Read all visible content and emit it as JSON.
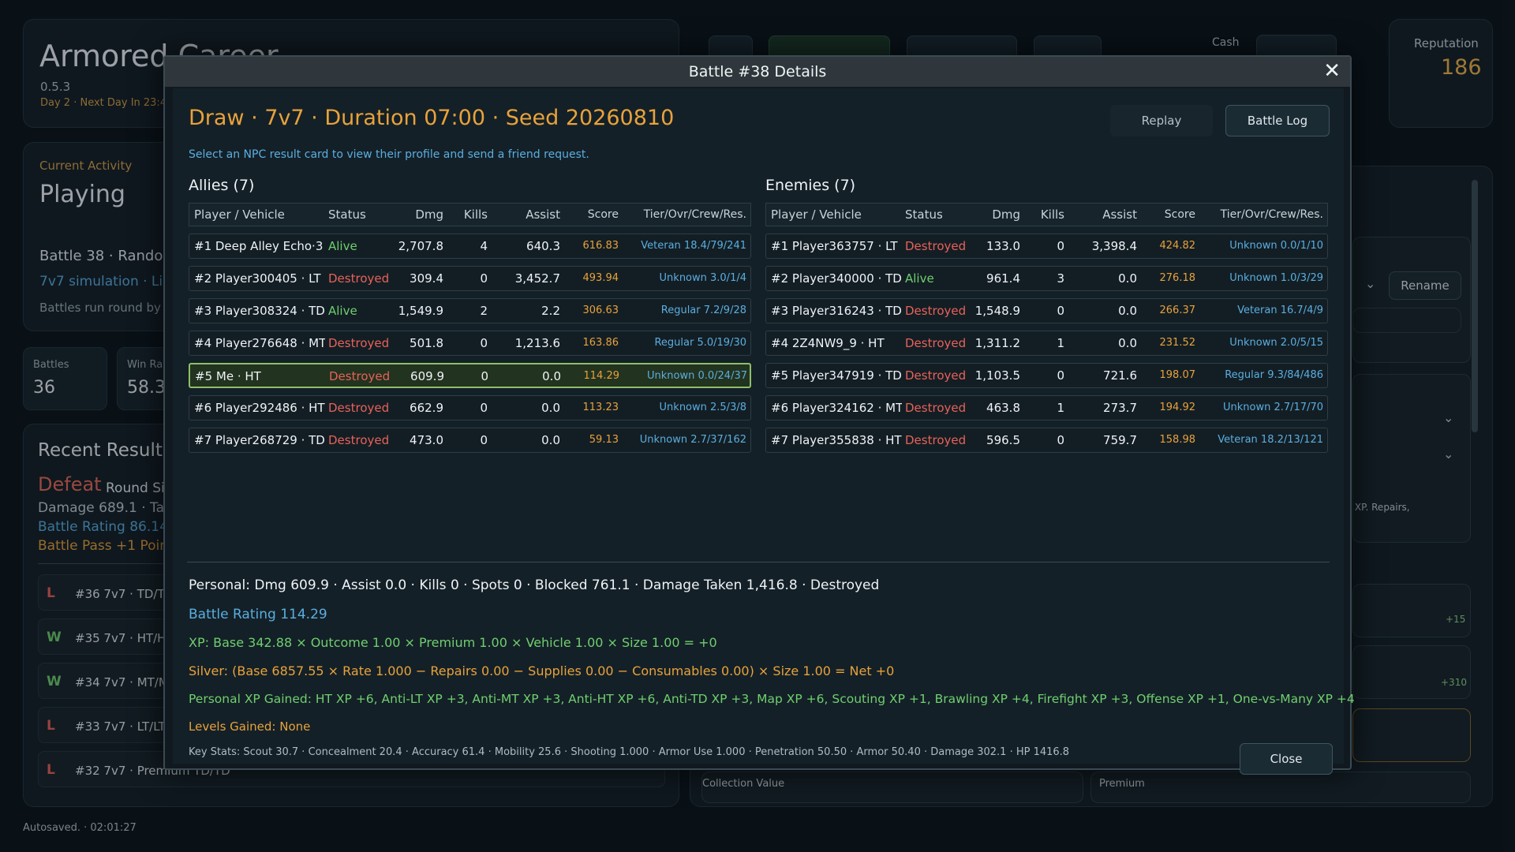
{
  "app": {
    "title": "Armored Career",
    "version": "0.5.3",
    "day": "Day 2 · Next Day In 23:45",
    "cash_label": "Cash",
    "reputation_label": "Reputation",
    "reputation_value": "186"
  },
  "activity": {
    "label": "Current Activity",
    "value": "Playing",
    "battle": "Battle 38 · Random",
    "sim": "7v7 simulation · Line",
    "note": "Battles run round by r"
  },
  "stats": {
    "battles_label": "Battles",
    "battles_value": "36",
    "winrate_label": "Win Ra",
    "winrate_value": "58.3"
  },
  "recent": {
    "title": "Recent Results",
    "outcome": "Defeat",
    "outcome_sub": "Round Si",
    "damage": "Damage 689.1 · Take",
    "rating": "Battle Rating 86.14",
    "pass": "Battle Pass +1 Point",
    "rows": [
      {
        "res": "L",
        "text": "#36  7v7 · TD/TD"
      },
      {
        "res": "W",
        "text": "#35  7v7 · HT/HT"
      },
      {
        "res": "W",
        "text": "#34  7v7 · MT/MT"
      },
      {
        "res": "L",
        "text": "#33  7v7 · LT/LT"
      },
      {
        "res": "L",
        "text": "#32  7v7 · Premium TD/TD"
      }
    ]
  },
  "right": {
    "rename": "Rename",
    "xp_repairs": "v XP. Repairs,",
    "plus_15": "+15",
    "plus_310": "+310",
    "collection": "Collection Value",
    "premium": "Premium"
  },
  "footer": {
    "status": "Autosaved.  ·  02:01:27"
  },
  "modal": {
    "title": "Battle #38 Details",
    "close_x": "✕",
    "summary": "Draw  ·  7v7  ·  Duration 07:00  ·  Seed 20260810",
    "hint": "Select an NPC result card to view their profile and send a friend request.",
    "replay": "Replay",
    "battle_log": "Battle Log",
    "close": "Close",
    "columns": {
      "name": "Player / Vehicle",
      "status": "Status",
      "dmg": "Dmg",
      "kills": "Kills",
      "assist": "Assist",
      "score": "Score",
      "tier": "Tier/Ovr/Crew/Res."
    },
    "allies_title": "Allies (7)",
    "enemies_title": "Enemies (7)",
    "allies": [
      {
        "name": "#1 Deep Alley Echo·3 ...",
        "status": "Alive",
        "dmg": "2,707.8",
        "kills": "4",
        "assist": "640.3",
        "score": "616.83",
        "tier": "Veteran 18.4/79/241"
      },
      {
        "name": "#2 Player300405 · LT",
        "status": "Destroyed",
        "dmg": "309.4",
        "kills": "0",
        "assist": "3,452.7",
        "score": "493.94",
        "tier": "Unknown 3.0/1/4"
      },
      {
        "name": "#3 Player308324 · TD",
        "status": "Alive",
        "dmg": "1,549.9",
        "kills": "2",
        "assist": "2.2",
        "score": "306.63",
        "tier": "Regular 7.2/9/28"
      },
      {
        "name": "#4 Player276648 · MT",
        "status": "Destroyed",
        "dmg": "501.8",
        "kills": "0",
        "assist": "1,213.6",
        "score": "163.86",
        "tier": "Regular 5.0/19/30"
      },
      {
        "name": "#5 Me · HT",
        "status": "Destroyed",
        "dmg": "609.9",
        "kills": "0",
        "assist": "0.0",
        "score": "114.29",
        "tier": "Unknown 0.0/24/37"
      },
      {
        "name": "#6 Player292486 · HT",
        "status": "Destroyed",
        "dmg": "662.9",
        "kills": "0",
        "assist": "0.0",
        "score": "113.23",
        "tier": "Unknown 2.5/3/8"
      },
      {
        "name": "#7 Player268729 · TD",
        "status": "Destroyed",
        "dmg": "473.0",
        "kills": "0",
        "assist": "0.0",
        "score": "59.13",
        "tier": "Unknown 2.7/37/162"
      }
    ],
    "enemies": [
      {
        "name": "#1 Player363757 · LT",
        "status": "Destroyed",
        "dmg": "133.0",
        "kills": "0",
        "assist": "3,398.4",
        "score": "424.82",
        "tier": "Unknown 0.0/1/10"
      },
      {
        "name": "#2 Player340000 · TD",
        "status": "Alive",
        "dmg": "961.4",
        "kills": "3",
        "assist": "0.0",
        "score": "276.18",
        "tier": "Unknown 1.0/3/29"
      },
      {
        "name": "#3 Player316243 · TD",
        "status": "Destroyed",
        "dmg": "1,548.9",
        "kills": "0",
        "assist": "0.0",
        "score": "266.37",
        "tier": "Veteran 16.7/4/9"
      },
      {
        "name": "#4 2Z4NW9_9 · HT",
        "status": "Destroyed",
        "dmg": "1,311.2",
        "kills": "1",
        "assist": "0.0",
        "score": "231.52",
        "tier": "Unknown 2.0/5/15"
      },
      {
        "name": "#5 Player347919 · TD",
        "status": "Destroyed",
        "dmg": "1,103.5",
        "kills": "0",
        "assist": "721.6",
        "score": "198.07",
        "tier": "Regular 9.3/84/486"
      },
      {
        "name": "#6 Player324162 · MT",
        "status": "Destroyed",
        "dmg": "463.8",
        "kills": "1",
        "assist": "273.7",
        "score": "194.92",
        "tier": "Unknown 2.7/17/70"
      },
      {
        "name": "#7 Player355838 · HT",
        "status": "Destroyed",
        "dmg": "596.5",
        "kills": "0",
        "assist": "759.7",
        "score": "158.98",
        "tier": "Veteran 18.2/13/121"
      }
    ],
    "personal": "Personal: Dmg 609.9  ·  Assist 0.0  ·  Kills 0  ·  Spots 0  ·  Blocked 761.1  ·  Damage Taken 1,416.8  ·  Destroyed",
    "rating": "Battle Rating 114.29",
    "xp": "XP: Base 342.88 × Outcome 1.00 × Premium 1.00 × Vehicle 1.00 × Size 1.00 = +0",
    "silver": "Silver: (Base 6857.55 × Rate 1.000 − Repairs 0.00 − Supplies 0.00 − Consumables 0.00) × Size 1.00 = Net +0",
    "personal_xp": "Personal XP Gained: HT XP +6, Anti-LT XP +3, Anti-MT XP +3, Anti-HT XP +6, Anti-TD XP +3, Map XP +6, Scouting XP +1, Brawling XP +4, Firefight XP +3, Offense XP +1, One-vs-Many XP +4",
    "levels": "Levels Gained: None",
    "keystats": "Key Stats: Scout 30.7 · Concealment 20.4 · Accuracy 61.4 · Mobility 25.6 · Shooting 1.000 · Armor Use 1.000 · Penetration 50.50 · Armor 50.40 · Damage 302.1 · HP 1416.8"
  }
}
